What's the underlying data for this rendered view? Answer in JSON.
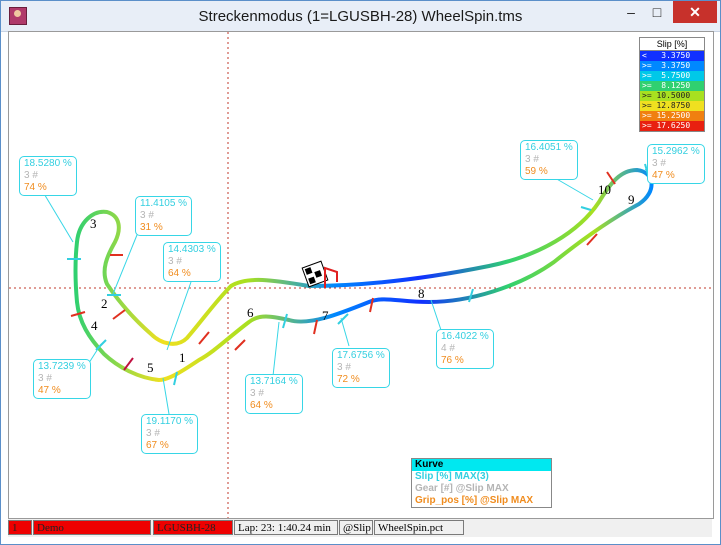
{
  "window": {
    "title": "Streckenmodus (1=LGUSBH-28)    WheelSpin.tms",
    "minimize_label": "–",
    "maximize_label": "□",
    "close_label": "✕"
  },
  "legend": {
    "title": "Slip [%]",
    "rows": [
      {
        "label": "<   3.3750",
        "color": "#1030ff"
      },
      {
        "label": ">=  3.3750",
        "color": "#0088ff"
      },
      {
        "label": ">=  5.7500",
        "color": "#00c8e8"
      },
      {
        "label": ">=  8.1250",
        "color": "#30d070"
      },
      {
        "label": ">= 10.5000",
        "color": "#a8e020"
      },
      {
        "label": ">= 12.8750",
        "color": "#f0e020"
      },
      {
        "label": ">= 15.2500",
        "color": "#f08010"
      },
      {
        "label": ">= 17.6250",
        "color": "#e82010"
      }
    ]
  },
  "callouts": [
    {
      "slip": "18.5280 %",
      "gear": "3 #",
      "grip": "74 %"
    },
    {
      "slip": "11.4105 %",
      "gear": "3 #",
      "grip": "31 %"
    },
    {
      "slip": "14.4303 %",
      "gear": "3 #",
      "grip": "64 %"
    },
    {
      "slip": "13.7239 %",
      "gear": "3 #",
      "grip": "47 %"
    },
    {
      "slip": "19.1170 %",
      "gear": "3 #",
      "grip": "67 %"
    },
    {
      "slip": "13.7164 %",
      "gear": "3 #",
      "grip": "64 %"
    },
    {
      "slip": "17.6756 %",
      "gear": "3 #",
      "grip": "72 %"
    },
    {
      "slip": "16.4022 %",
      "gear": "4 #",
      "grip": "76 %"
    },
    {
      "slip": "16.4051 %",
      "gear": "3 #",
      "grip": "59 %"
    },
    {
      "slip": "15.2962 %",
      "gear": "3 #",
      "grip": "47 %"
    }
  ],
  "turns": [
    "1",
    "2",
    "3",
    "4",
    "5",
    "6",
    "7",
    "8",
    "9",
    "10"
  ],
  "kurve": {
    "title": "Kurve",
    "items": [
      {
        "label": "Slip [%] MAX(3)",
        "color": "#33cfe0"
      },
      {
        "label": "Gear [#] @Slip MAX",
        "color": "#b5b5b5"
      },
      {
        "label": "Grip_pos [%] @Slip MAX",
        "color": "#f08c1e"
      }
    ]
  },
  "statusbar": {
    "lap_number": "1",
    "driver": "Demo",
    "car": "LGUSBH-28",
    "lap": "Lap: 23: 1:40.24 min",
    "channel": "@Slip",
    "file": "WheelSpin.pct"
  }
}
